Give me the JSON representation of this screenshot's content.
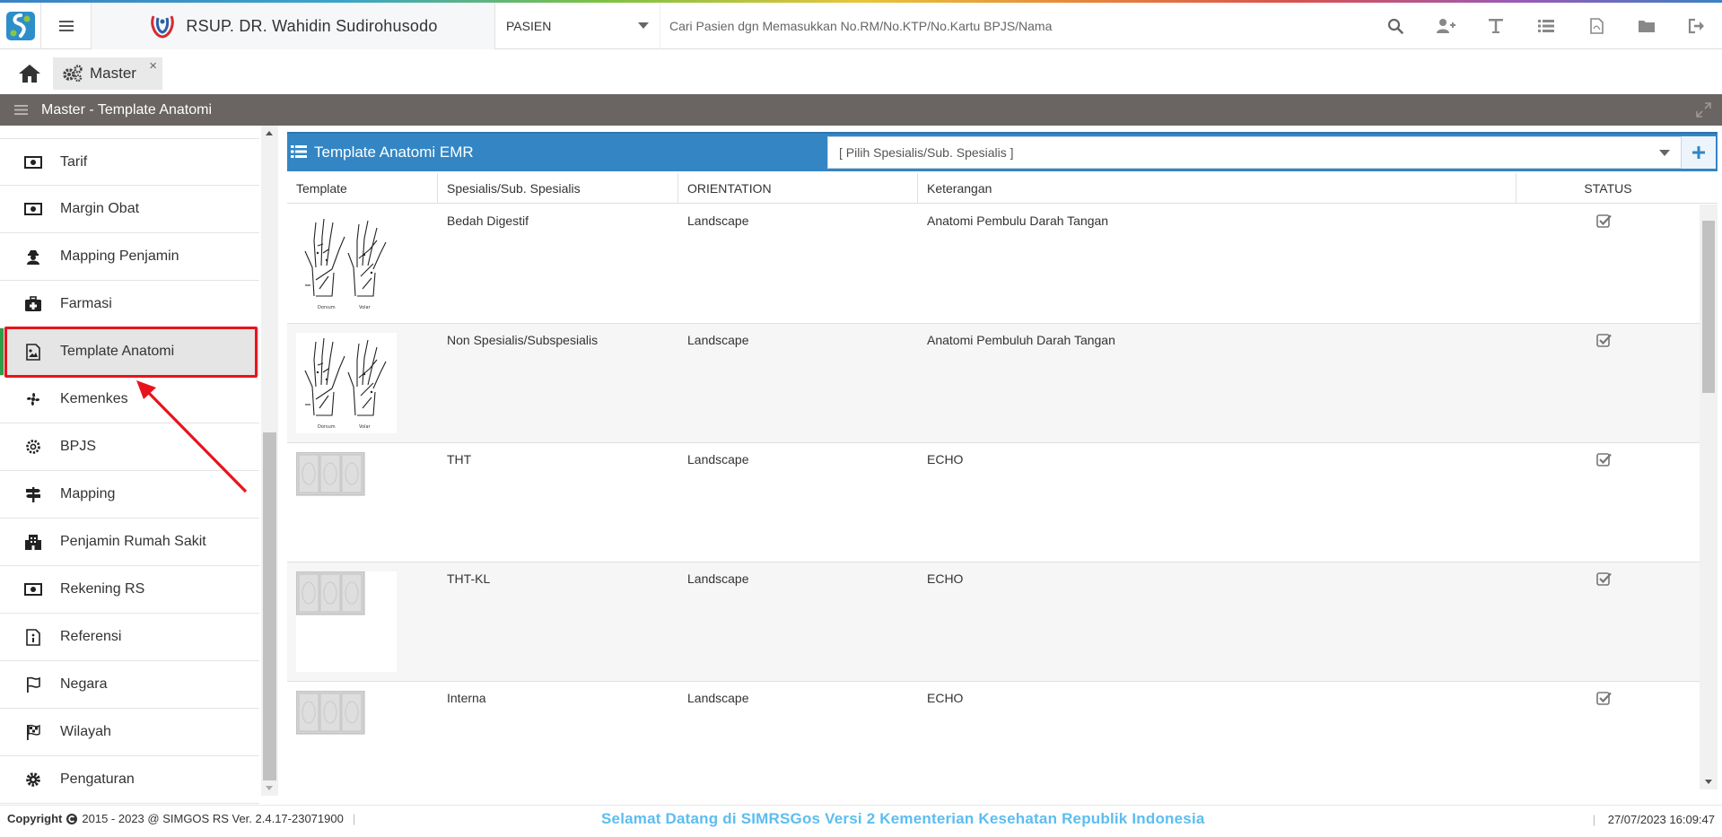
{
  "header": {
    "hospital_name": "RSUP. DR. Wahidin Sudirohusodo",
    "mode": "PASIEN",
    "patient_search_placeholder": "Cari Pasien dgn Memasukkan No.RM/No.KTP/No.Kartu BPJS/Nama",
    "toolbar_icons": [
      "search-icon",
      "add-user-icon",
      "text-icon",
      "list-icon",
      "pdf-file-icon",
      "folder-icon",
      "logout-icon"
    ]
  },
  "tabs": {
    "home_icon": "home-icon",
    "items": [
      {
        "label": "Master",
        "icon": "gears-icon",
        "close": "×"
      }
    ]
  },
  "page_header": {
    "title": "Master - Template Anatomi"
  },
  "sidebar": {
    "items": [
      {
        "label": "Tarif",
        "icon": "money-icon",
        "active": false
      },
      {
        "label": "Margin Obat",
        "icon": "money-icon",
        "active": false
      },
      {
        "label": "Mapping Penjamin",
        "icon": "user-secret-icon",
        "active": false
      },
      {
        "label": "Farmasi",
        "icon": "medkit-icon",
        "active": false
      },
      {
        "label": "Template Anatomi",
        "icon": "image-file-icon",
        "active": true
      },
      {
        "label": "Kemenkes",
        "icon": "fan-icon",
        "active": false
      },
      {
        "label": "BPJS",
        "icon": "gear-outline-icon",
        "active": false
      },
      {
        "label": "Mapping",
        "icon": "signpost-icon",
        "active": false
      },
      {
        "label": "Penjamin Rumah Sakit",
        "icon": "building-icon",
        "active": false
      },
      {
        "label": "Rekening RS",
        "icon": "money-icon",
        "active": false
      },
      {
        "label": "Referensi",
        "icon": "file-document-icon",
        "active": false
      },
      {
        "label": "Negara",
        "icon": "flag-icon",
        "active": false
      },
      {
        "label": "Wilayah",
        "icon": "checkered-flag-icon",
        "active": false
      },
      {
        "label": "Pengaturan",
        "icon": "gear-icon",
        "active": false
      }
    ]
  },
  "panel": {
    "title": "Template Anatomi EMR",
    "specialist_select": "[ Pilih Spesialis/Sub. Spesialis ]",
    "add_button": "+",
    "columns": [
      "Template",
      "Spesialis/Sub. Spesialis",
      "ORIENTATION",
      "Keterangan",
      "STATUS"
    ],
    "rows": [
      {
        "template": "hand-anatomy",
        "spesialis": "Bedah Digestif",
        "orientation": "Landscape",
        "keterangan": "Anatomi Pembulu Darah Tangan",
        "status": "checked"
      },
      {
        "template": "hand-anatomy",
        "spesialis": "Non Spesialis/Subspesialis",
        "orientation": "Landscape",
        "keterangan": "Anatomi Pembuluh Darah Tangan",
        "status": "checked"
      },
      {
        "template": "echo",
        "spesialis": "THT",
        "orientation": "Landscape",
        "keterangan": "ECHO",
        "status": "checked"
      },
      {
        "template": "echo",
        "spesialis": "THT-KL",
        "orientation": "Landscape",
        "keterangan": "ECHO",
        "status": "checked"
      },
      {
        "template": "echo",
        "spesialis": "Interna",
        "orientation": "Landscape",
        "keterangan": "ECHO",
        "status": "checked"
      }
    ]
  },
  "footer": {
    "copyright_label": "Copyright",
    "copyright_text": "2015 - 2023 @ SIMGOS RS Ver. 2.4.17-23071900",
    "welcome": "Selamat Datang di SIMRSGos Versi 2 Kementerian Kesehatan Republik Indonesia",
    "datetime": "27/07/2023 16:09:47"
  },
  "colors": {
    "panel_header": "#3386c3",
    "page_header": "#6a6563",
    "active_marker": "#2e9e49",
    "highlight_box": "#e8141b",
    "welcome_text": "#5cbdf0"
  }
}
